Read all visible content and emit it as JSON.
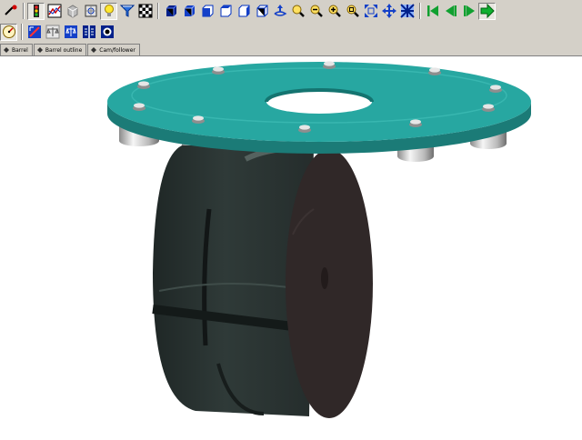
{
  "toolbar": {
    "row1": [
      {
        "name": "pick-mode-icon"
      },
      {
        "name": "traffic-light-icon"
      },
      {
        "name": "graph-icon"
      },
      {
        "name": "box-shade-icon"
      },
      {
        "name": "render-settings-icon"
      },
      {
        "name": "lightbulb-icon"
      },
      {
        "name": "filter-icon"
      },
      {
        "name": "checkerboard-icon"
      },
      {
        "name": "solid-view-icon"
      },
      {
        "name": "shaded-view-icon"
      },
      {
        "name": "front-view-icon"
      },
      {
        "name": "top-view-icon"
      },
      {
        "name": "side-view-icon"
      },
      {
        "name": "iso-view-icon"
      },
      {
        "name": "rotate-icon"
      },
      {
        "name": "zoom-window-icon"
      },
      {
        "name": "zoom-out-icon"
      },
      {
        "name": "zoom-in-icon"
      },
      {
        "name": "zoom-fit-icon"
      },
      {
        "name": "fit-all-icon"
      },
      {
        "name": "pan-icon"
      },
      {
        "name": "grid-pattern-icon"
      },
      {
        "name": "first-frame-icon"
      },
      {
        "name": "previous-frame-icon"
      },
      {
        "name": "next-frame-icon"
      },
      {
        "name": "play-icon"
      }
    ],
    "row2": [
      {
        "name": "speedometer-icon"
      },
      {
        "name": "measure-icon"
      },
      {
        "name": "balance-icon"
      },
      {
        "name": "scale-icon"
      },
      {
        "name": "split-view-icon"
      },
      {
        "name": "capture-icon"
      }
    ]
  },
  "tabs": [
    {
      "label": "Barrel"
    },
    {
      "label": "Barrel outline"
    },
    {
      "label": "Cam/follower"
    }
  ],
  "colors": {
    "toolbar_bg": "#d4d0c8",
    "plate_top": "#27a7a1",
    "plate_edge": "#1b7b77",
    "barrel_dark": "#2c3533",
    "barrel_face": "#302828"
  }
}
